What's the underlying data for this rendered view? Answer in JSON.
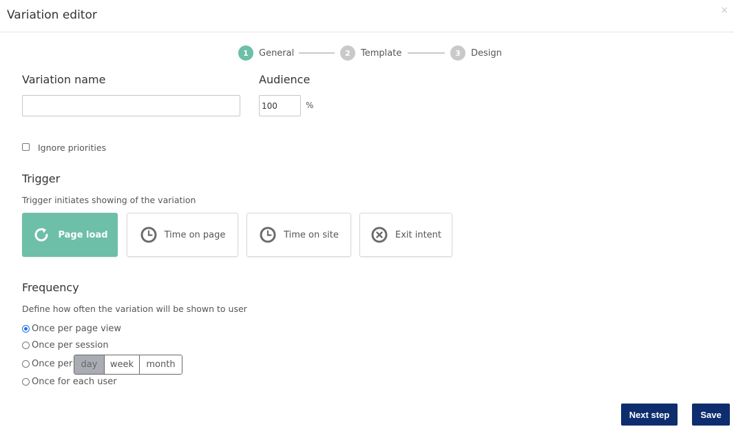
{
  "modal": {
    "title": "Variation editor",
    "close_label": "×"
  },
  "steps": [
    {
      "num": "1",
      "label": "General",
      "active": true
    },
    {
      "num": "2",
      "label": "Template",
      "active": false
    },
    {
      "num": "3",
      "label": "Design",
      "active": false
    }
  ],
  "variation_name": {
    "label": "Variation name",
    "value": ""
  },
  "audience": {
    "label": "Audience",
    "value": "100",
    "unit": "%"
  },
  "ignore_priorities": {
    "label": "Ignore priorities",
    "checked": false
  },
  "trigger": {
    "title": "Trigger",
    "description": "Trigger initiates showing of the variation",
    "options": [
      {
        "label": "Page load",
        "icon": "refresh-icon",
        "selected": true
      },
      {
        "label": "Time on page",
        "icon": "clock-icon",
        "selected": false
      },
      {
        "label": "Time on site",
        "icon": "clock-icon",
        "selected": false
      },
      {
        "label": "Exit intent",
        "icon": "close-circle-icon",
        "selected": false
      }
    ]
  },
  "frequency": {
    "title": "Frequency",
    "description": "Define how often the variation will be shown to user",
    "options": [
      {
        "label": "Once per page view",
        "checked": true
      },
      {
        "label": "Once per session",
        "checked": false
      },
      {
        "label": "Once per",
        "checked": false
      },
      {
        "label": "Once for each user",
        "checked": false
      }
    ],
    "period_options": [
      "day",
      "week",
      "month"
    ],
    "period_selected": "day"
  },
  "buttons": {
    "next": "Next step",
    "save": "Save"
  },
  "colors": {
    "accent": "#6dbfa7",
    "primary": "#0e2d6e",
    "step_inactive": "#c9c9c9",
    "radio": "#1a73e8"
  }
}
